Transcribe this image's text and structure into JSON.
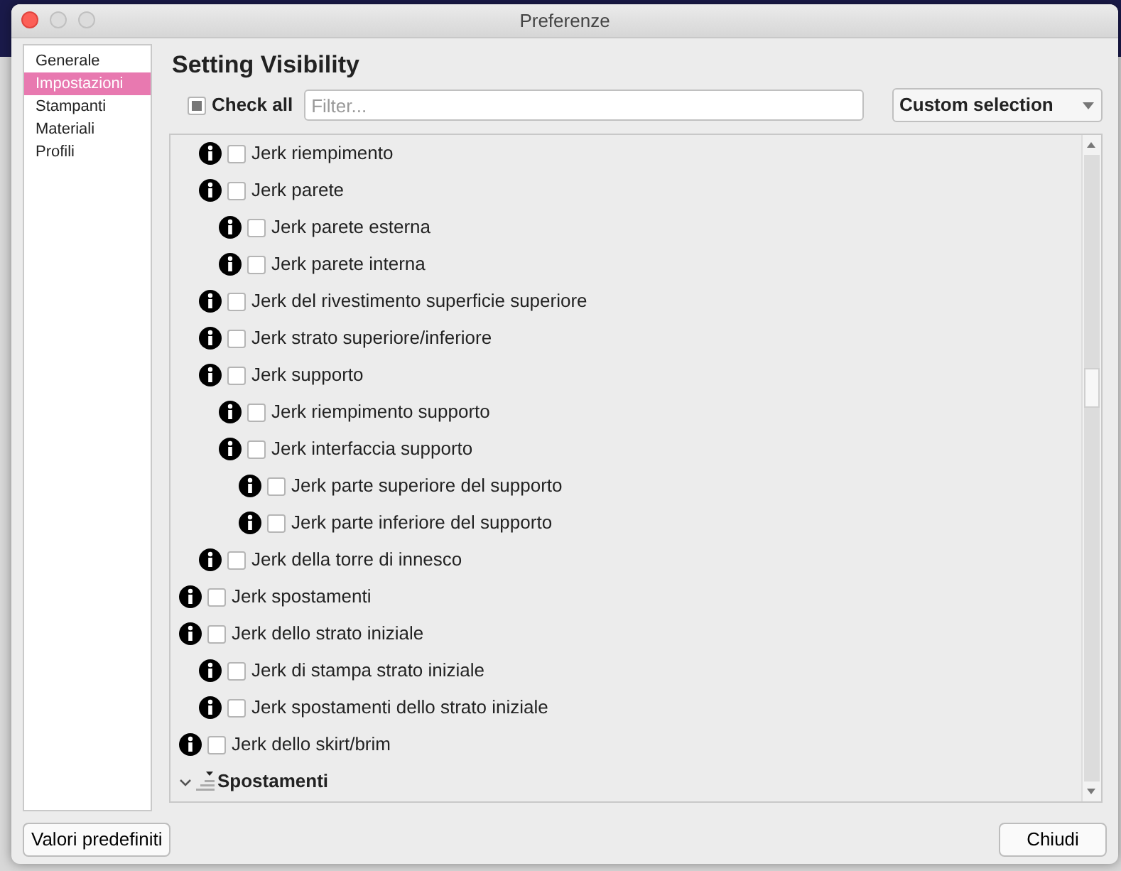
{
  "window": {
    "title": "Preferenze"
  },
  "sidebar": {
    "items": [
      {
        "label": "Generale",
        "selected": false
      },
      {
        "label": "Impostazioni",
        "selected": true
      },
      {
        "label": "Stampanti",
        "selected": false
      },
      {
        "label": "Materiali",
        "selected": false
      },
      {
        "label": "Profili",
        "selected": false
      }
    ]
  },
  "heading": "Setting Visibility",
  "check_all": {
    "label": "Check all",
    "indeterminate": true
  },
  "filter": {
    "placeholder": "Filter..."
  },
  "preset": {
    "value": "Custom selection"
  },
  "settings": [
    {
      "kind": "group",
      "children": [
        {
          "kind": "setting",
          "label": "Jerk riempimento",
          "checked": false
        },
        {
          "kind": "setting",
          "label": "Jerk parete",
          "checked": false,
          "children": [
            {
              "kind": "setting",
              "label": "Jerk parete esterna",
              "checked": false
            },
            {
              "kind": "setting",
              "label": "Jerk parete interna",
              "checked": false
            }
          ]
        },
        {
          "kind": "setting",
          "label": "Jerk del rivestimento superficie superiore",
          "checked": false
        },
        {
          "kind": "setting",
          "label": "Jerk strato superiore/inferiore",
          "checked": false
        },
        {
          "kind": "setting",
          "label": "Jerk supporto",
          "checked": false,
          "children": [
            {
              "kind": "setting",
              "label": "Jerk riempimento supporto",
              "checked": false
            },
            {
              "kind": "setting",
              "label": "Jerk interfaccia supporto",
              "checked": false,
              "children": [
                {
                  "kind": "setting",
                  "label": "Jerk parte superiore del supporto",
                  "checked": false
                },
                {
                  "kind": "setting",
                  "label": "Jerk parte inferiore del supporto",
                  "checked": false
                }
              ]
            }
          ]
        },
        {
          "kind": "setting",
          "label": "Jerk della torre di innesco",
          "checked": false
        }
      ]
    },
    {
      "kind": "setting",
      "label": "Jerk spostamenti",
      "checked": false
    },
    {
      "kind": "setting",
      "label": "Jerk dello strato iniziale",
      "checked": false,
      "children": [
        {
          "kind": "setting",
          "label": "Jerk di stampa strato iniziale",
          "checked": false
        },
        {
          "kind": "setting",
          "label": "Jerk spostamenti dello strato iniziale",
          "checked": false
        }
      ]
    },
    {
      "kind": "setting",
      "label": "Jerk dello skirt/brim",
      "checked": false
    },
    {
      "kind": "category",
      "label": "Spostamenti",
      "expanded": true
    }
  ],
  "buttons": [
    {
      "label": "Valori predefiniti"
    },
    {
      "label": "Chiudi"
    }
  ]
}
